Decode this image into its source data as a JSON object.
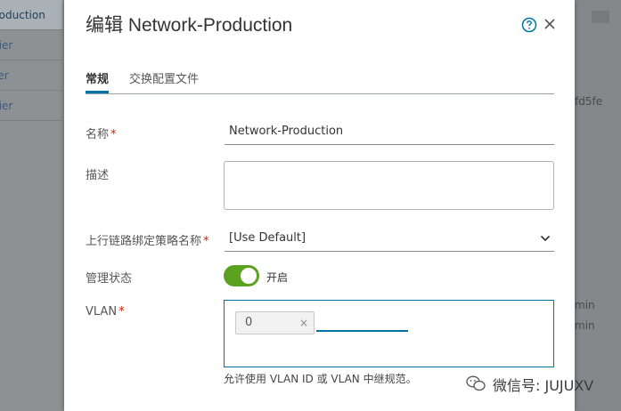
{
  "background": {
    "left_items": [
      "roduction",
      "tier",
      "ier",
      "tier"
    ],
    "right_texts": [
      "fd5fe",
      "min",
      "min"
    ]
  },
  "modal": {
    "title": "编辑 Network-Production",
    "tabs": [
      "常规",
      "交换配置文件"
    ],
    "fields": {
      "name_label": "名称",
      "name_value": "Network-Production",
      "description_label": "描述",
      "description_value": "",
      "uplink_label": "上行链路绑定策略名称",
      "uplink_value": "[Use Default]",
      "admin_label": "管理状态",
      "admin_value": "开启",
      "vlan_label": "VLAN",
      "vlan_tag": "0",
      "vlan_tag_remove": "×",
      "vlan_hint": "允许使用 VLAN ID 或 VLAN 中继规范。"
    },
    "required_mark": "*"
  },
  "watermark": {
    "text": "微信号: JUJUXV"
  },
  "colors": {
    "accent": "#0072a3",
    "toggle_on": "#5aa220",
    "required": "#c92100"
  }
}
